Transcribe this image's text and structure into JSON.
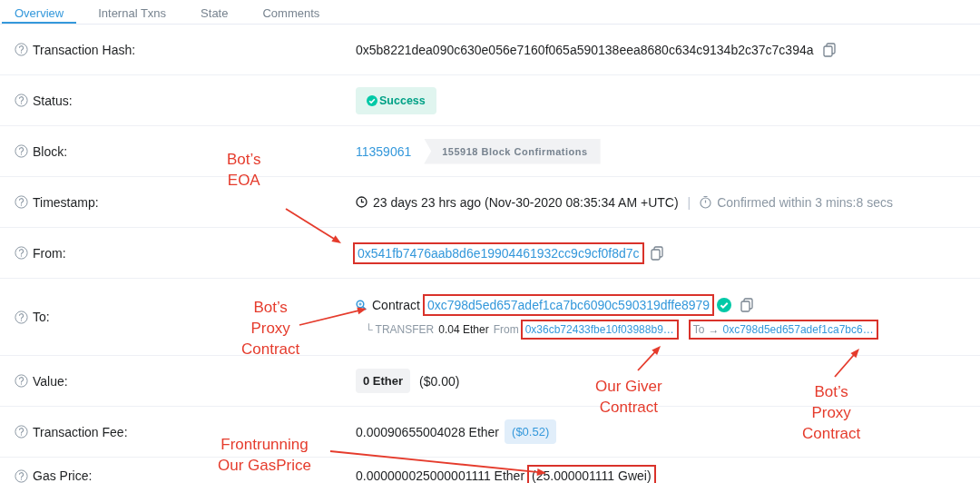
{
  "tabs": [
    {
      "label": "Overview",
      "selected": true
    },
    {
      "label": "Internal Txns",
      "selected": false
    },
    {
      "label": "State",
      "selected": false
    },
    {
      "label": "Comments",
      "selected": false
    }
  ],
  "rows": [
    {
      "kind": "hash",
      "label": "Transaction Hash:",
      "value": "0x5b8221dea090c630e056e7160f065a590138eea8680c634c9134b2c37c7c394a"
    },
    {
      "kind": "status",
      "label": "Status:",
      "value": "Success"
    },
    {
      "kind": "block",
      "label": "Block:",
      "value": "11359061",
      "badge": "155918 Block Confirmations"
    },
    {
      "kind": "timestamp",
      "label": "Timestamp:",
      "value": "23 days 23 hrs ago (Nov-30-2020 08:35:34 AM +UTC)",
      "separator": "|",
      "note": "Confirmed within 3 mins:8 secs"
    },
    {
      "kind": "address",
      "label": "From:",
      "value": "0x541fb7476aab8d6e19904461932cc9c9cf0f8d7c",
      "boxed": true
    },
    {
      "kind": "contract",
      "label": "To:",
      "prefix": "Contract",
      "value": "0xc798d5ed657adef1ca7bc6090c590319dffe8979",
      "boxed": true,
      "verified": true,
      "transfer": {
        "tag": "└ TRANSFER",
        "amount": "0.04 Ether",
        "from_label": "From",
        "from": "0x36cb72433fbe10f03988b9…",
        "from_boxed": true,
        "to_label": "To",
        "arrow": "→",
        "to": "0xc798d5ed657adef1ca7bc6…",
        "to_boxed": true
      }
    },
    {
      "kind": "value",
      "label": "Value:",
      "badge": "0 Ether",
      "value": "($0.00)"
    },
    {
      "kind": "fee",
      "label": "Transaction Fee:",
      "value": "0.00090655004028 Ether",
      "badge": "($0.52)"
    },
    {
      "kind": "gas",
      "label": "Gas Price:",
      "value": "0.000000025000001111 Ether",
      "extra": "(25.000001111 Gwei)",
      "boxed": true
    }
  ],
  "annotations": [
    {
      "lines": [
        "Bot’s",
        "EOA"
      ]
    },
    {
      "lines": [
        "Bot’s",
        "Proxy",
        "Contract"
      ]
    },
    {
      "lines": [
        "Our Giver",
        "Contract"
      ]
    },
    {
      "lines": [
        "Bot’s",
        "Proxy",
        "Contract"
      ]
    },
    {
      "lines": [
        "Frontrunning",
        "Our GasPrice"
      ]
    }
  ]
}
